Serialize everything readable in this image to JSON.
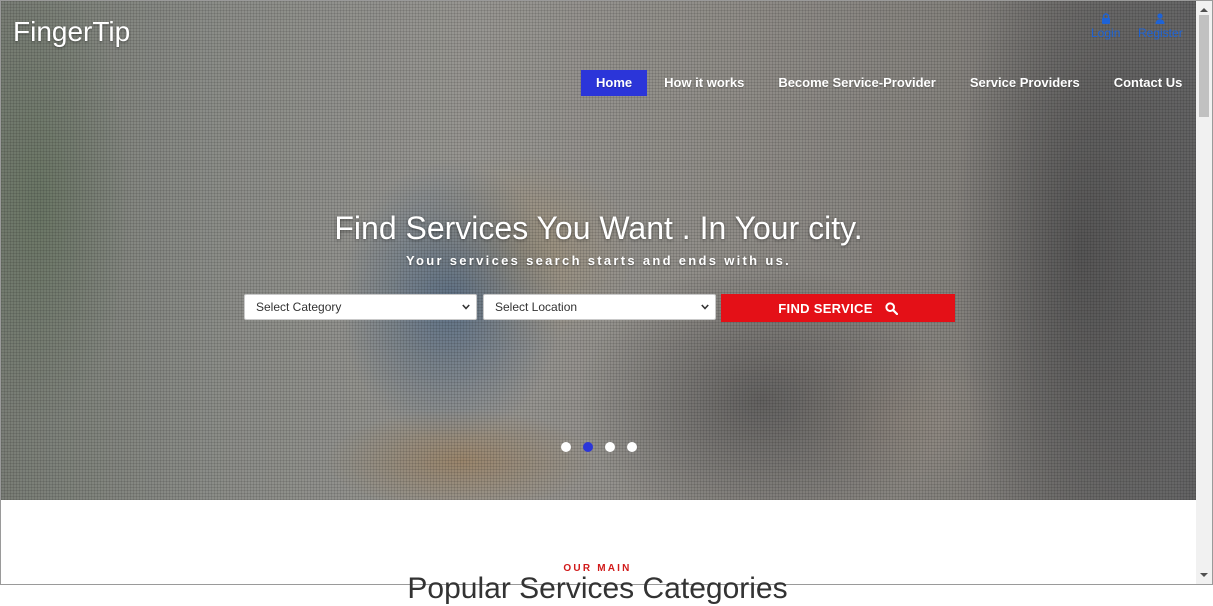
{
  "brand": {
    "logo": "FingerTip"
  },
  "auth": {
    "login_label": "Login",
    "register_label": "Register"
  },
  "nav": {
    "items": [
      {
        "label": "Home",
        "active": true
      },
      {
        "label": "How it works",
        "active": false
      },
      {
        "label": "Become Service-Provider",
        "active": false
      },
      {
        "label": "Service Providers",
        "active": false
      },
      {
        "label": "Contact Us",
        "active": false
      }
    ]
  },
  "hero": {
    "headline": "Find Services You Want . In Your city.",
    "subline": "Your services search starts and ends with us.",
    "category_select": "Select Category",
    "location_select": "Select Location",
    "find_button": "FIND SERVICE",
    "slides_total": 4,
    "active_slide": 2
  },
  "section": {
    "kicker": "OUR MAIN",
    "title": "Popular Services Categories"
  },
  "colors": {
    "nav_active": "#2b35d9",
    "cta": "#e41017",
    "link": "#1e63d6",
    "kicker": "#d11a1a"
  },
  "icons": [
    "lock-icon",
    "user-icon",
    "search-icon",
    "chevron-down-icon"
  ]
}
